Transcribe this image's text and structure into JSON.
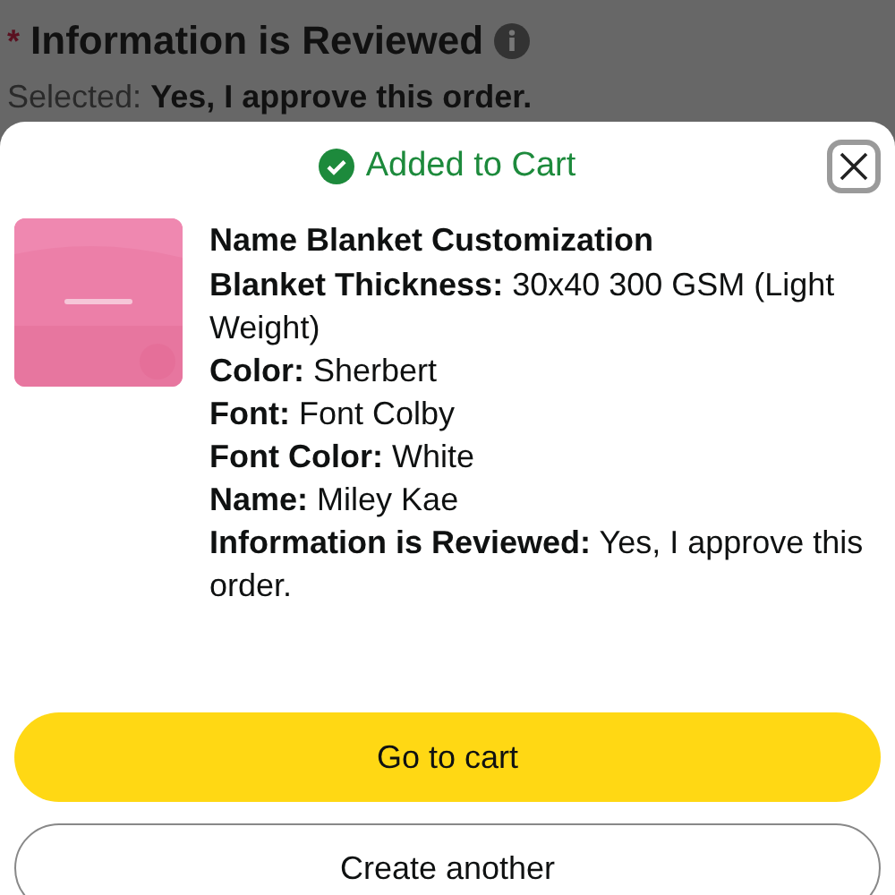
{
  "background": {
    "required_mark": "*",
    "title": "Information is Reviewed",
    "selected": "Selected: **Yes, I approve this order.**"
  },
  "sheet": {
    "status": "Added to Cart",
    "product": {
      "name": "Name Blanket Customization",
      "details": [
        {
          "label": "Blanket Thickness:",
          "value": "30x40 300 GSM (Light Weight)"
        },
        {
          "label": "Color:",
          "value": "Sherbert"
        },
        {
          "label": "Font:",
          "value": "Font Colby"
        },
        {
          "label": "Font Color:",
          "value": "White"
        },
        {
          "label": "Name:",
          "value": "Miley Kae"
        },
        {
          "label": "Information is Reviewed:",
          "value": "Yes, I approve this order."
        }
      ]
    },
    "buttons": [
      {
        "label": "Go to cart",
        "kind": "primary"
      },
      {
        "label": "Create another",
        "kind": "secondary"
      }
    ]
  }
}
